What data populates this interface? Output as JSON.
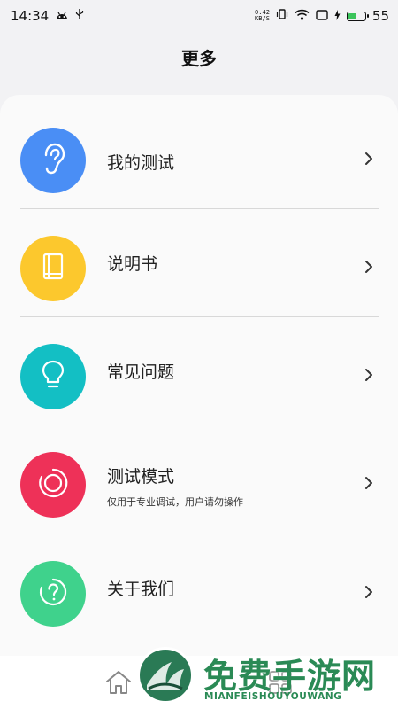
{
  "status_bar": {
    "time": "14:34",
    "net_speed_value": "0.42",
    "net_speed_unit": "KB/S",
    "battery": "55",
    "battery_level": 0.55,
    "battery_color": "#3bc45b"
  },
  "header": {
    "title": "更多"
  },
  "menu": {
    "items": [
      {
        "label": "我的测试",
        "icon": "ear-icon",
        "color": "#4a8ef5"
      },
      {
        "label": "说明书",
        "icon": "book-icon",
        "color": "#fcc82d"
      },
      {
        "label": "常见问题",
        "icon": "lightbulb-icon",
        "color": "#13bfc4"
      },
      {
        "label": "测试模式",
        "sub": "仅用于专业调试，用户请勿操作",
        "icon": "ring-icon",
        "color": "#ee3158"
      },
      {
        "label": "关于我们",
        "icon": "question-icon",
        "color": "#3fd28c"
      }
    ]
  },
  "watermark": {
    "title": "免费手游网",
    "subtitle": "MIANFEISHOUYOUWANG"
  }
}
